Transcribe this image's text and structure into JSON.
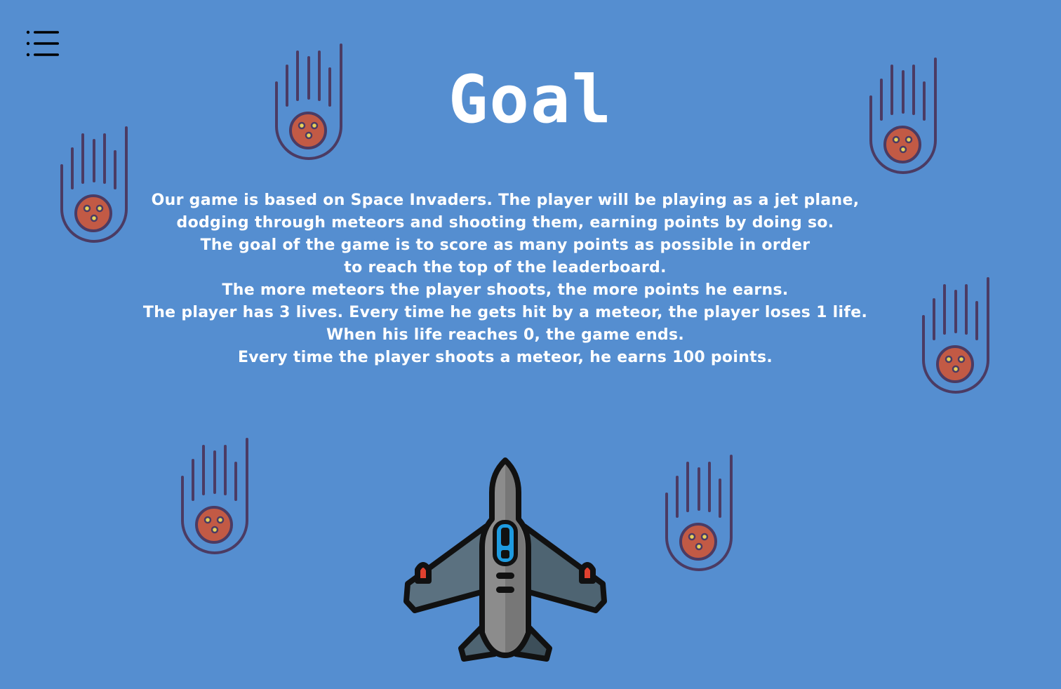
{
  "page": {
    "background_color": "#558ed0",
    "text_color": "#ffffff"
  },
  "menu": {
    "icon": "menu-list-icon"
  },
  "title": "Goal",
  "description": {
    "lines": [
      "Our game is based on Space Invaders. The player will be playing as a jet plane,",
      "dodging through meteors and shooting them, earning points by doing so.",
      "The goal of the game is to score as many points as possible in order",
      "to reach the top of the leaderboard.",
      "The more meteors the player shoots, the more points he earns.",
      "The player has 3 lives. Every time he gets hit by a meteor, the player loses 1 life.",
      "When his life reaches 0, the game ends.",
      "Every time the player shoots a meteor, he earns 100 points."
    ]
  },
  "decorations": {
    "meteor_icon": "falling-meteor-icon",
    "meteor_colors": {
      "trail": "#4b3b63",
      "rock": "#c25a45",
      "crater": "#e6d35a"
    },
    "jet_icon": "fighter-jet-icon",
    "jet_colors": {
      "body": "#8c8c8c",
      "wings": "#5b7180",
      "cockpit": "#1e9be0",
      "tips": "#e0412f"
    }
  }
}
